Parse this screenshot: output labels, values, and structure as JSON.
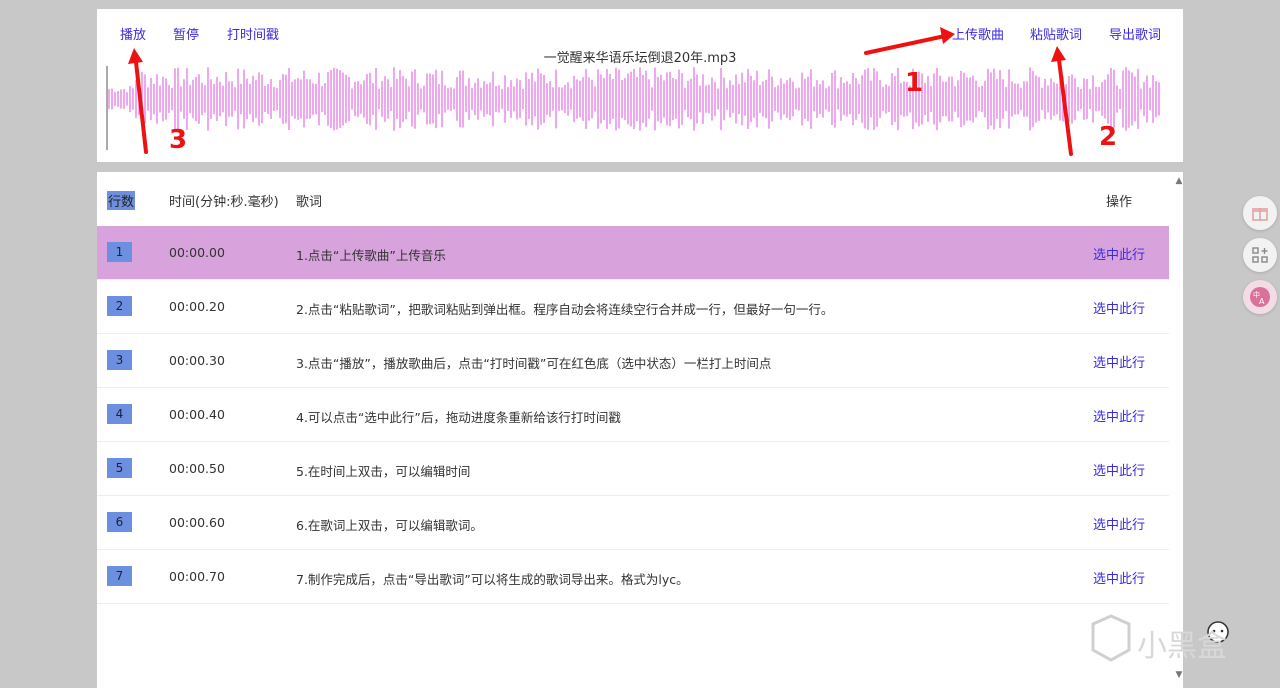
{
  "toolbar": {
    "play_label": "播放",
    "pause_label": "暂停",
    "timestamp_label": "打时间戳",
    "upload_label": "上传歌曲",
    "paste_label": "粘贴歌词",
    "export_label": "导出歌词"
  },
  "player": {
    "file_name": "一觉醒来华语乐坛倒退20年.mp3",
    "waveform_color": "#e882e8"
  },
  "table": {
    "headers": {
      "row_num": "行数",
      "time": "时间(分钟:秒.毫秒)",
      "lyric": "歌词",
      "action": "操作"
    },
    "rows": [
      {
        "num": "1",
        "time": "00:00.00",
        "lyric": "1.点击“上传歌曲”上传音乐",
        "action": "选中此行",
        "selected": true
      },
      {
        "num": "2",
        "time": "00:00.20",
        "lyric": "2.点击“粘贴歌词”，把歌词粘贴到弹出框。程序自动会将连续空行合并成一行，但最好一句一行。",
        "action": "选中此行",
        "selected": false
      },
      {
        "num": "3",
        "time": "00:00.30",
        "lyric": "3.点击“播放”，播放歌曲后，点击“打时间戳”可在红色底（选中状态）一栏打上时间点",
        "action": "选中此行",
        "selected": false
      },
      {
        "num": "4",
        "time": "00:00.40",
        "lyric": "4.可以点击“选中此行”后，拖动进度条重新给该行打时间戳",
        "action": "选中此行",
        "selected": false
      },
      {
        "num": "5",
        "time": "00:00.50",
        "lyric": "5.在时间上双击，可以编辑时间",
        "action": "选中此行",
        "selected": false
      },
      {
        "num": "6",
        "time": "00:00.60",
        "lyric": "6.在歌词上双击，可以编辑歌词。",
        "action": "选中此行",
        "selected": false
      },
      {
        "num": "7",
        "time": "00:00.70",
        "lyric": "7.制作完成后，点击“导出歌词”可以将生成的歌词导出来。格式为lyc。",
        "action": "选中此行",
        "selected": false
      }
    ]
  },
  "annotations": {
    "one": "1",
    "two": "2",
    "three": "3",
    "color": "#ee1111"
  },
  "watermark": {
    "text": "小黑盒"
  },
  "side_icons": [
    "gift-icon",
    "add-app-icon",
    "translate-icon"
  ]
}
